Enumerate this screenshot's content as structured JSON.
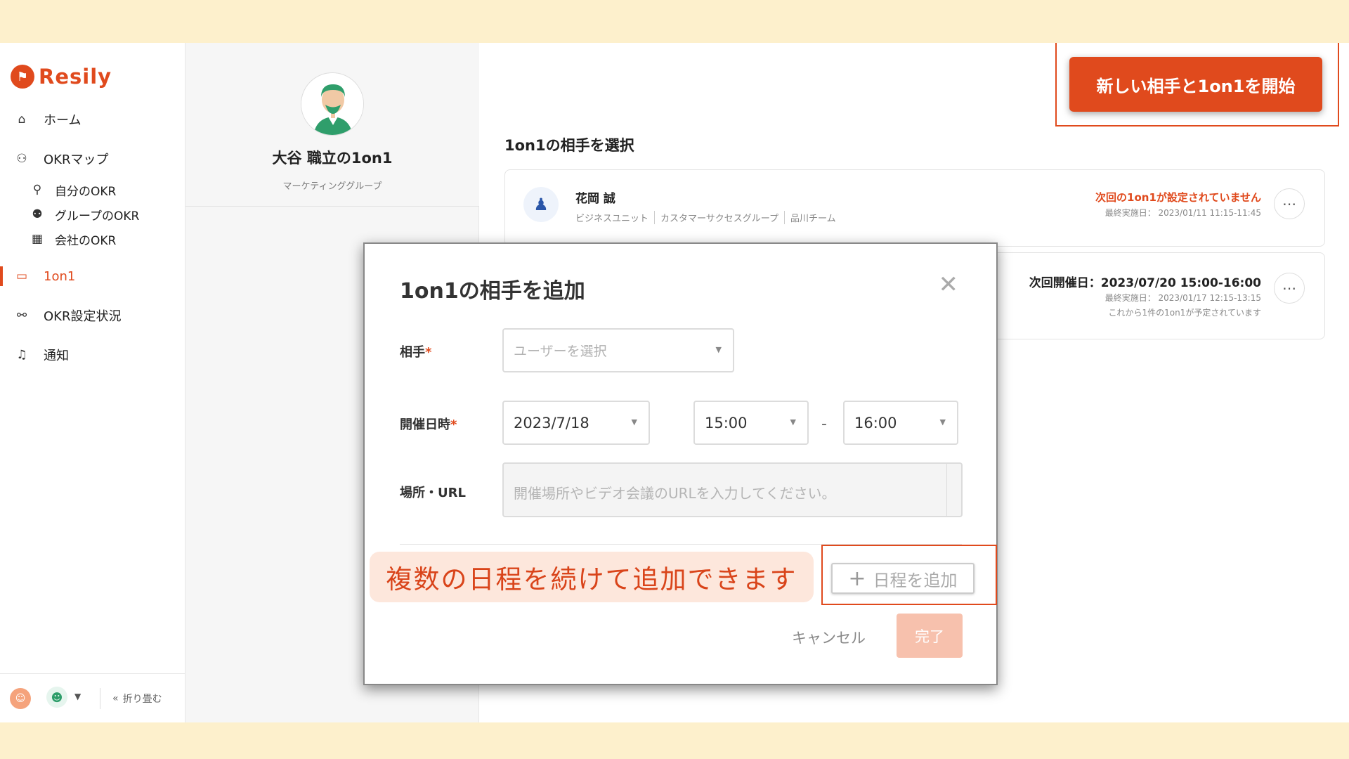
{
  "app": {
    "logo_text": "Resily",
    "brand_color": "#e04a1d"
  },
  "sidebar": {
    "items": [
      {
        "label": "ホーム",
        "icon": "home-icon"
      },
      {
        "label": "OKRマップ",
        "icon": "okr-map-icon"
      },
      {
        "label": "自分のOKR",
        "icon": "my-okr-icon"
      },
      {
        "label": "グループのOKR",
        "icon": "group-icon"
      },
      {
        "label": "会社のOKR",
        "icon": "building-icon"
      },
      {
        "label": "1on1",
        "icon": "chat-icon"
      },
      {
        "label": "OKR設定状況",
        "icon": "status-icon"
      },
      {
        "label": "通知",
        "icon": "bell-icon"
      }
    ],
    "footer": {
      "collapse_label": "折り畳む"
    }
  },
  "profile": {
    "name": "大谷 職立の1on1",
    "group": "マーケティンググループ"
  },
  "main": {
    "start_button": "新しい相手と1on1を開始",
    "section_title": "1on1の相手を選択",
    "persons": [
      {
        "name": "花岡 誠",
        "tags": [
          "ビジネスユニット",
          "カスタマーサクセスグループ",
          "品川チーム"
        ],
        "status": "次回の1on1が設定されていません",
        "last": "最終実施日： 2023/01/11 11:15-11:45"
      },
      {
        "next": "次回開催日：2023/07/20 15:00-16:00",
        "last": "最終実施日： 2023/01/17 12:15-13:15",
        "scheduled": "これから1件の1on1が予定されています"
      }
    ]
  },
  "modal": {
    "title": "1on1の相手を追加",
    "partner_label": "相手",
    "partner_placeholder": "ユーザーを選択",
    "datetime_label": "開催日時",
    "date_value": "2023/7/18",
    "start_time": "15:00",
    "end_time": "16:00",
    "dash": "-",
    "place_label": "場所・URL",
    "place_placeholder": "開催場所やビデオ会議のURLを入力してください。",
    "add_date_label": "日程を追加",
    "cancel_label": "キャンセル",
    "done_label": "完了",
    "required_mark": "*"
  },
  "callout": {
    "text": "複数の日程を続けて追加できます"
  }
}
